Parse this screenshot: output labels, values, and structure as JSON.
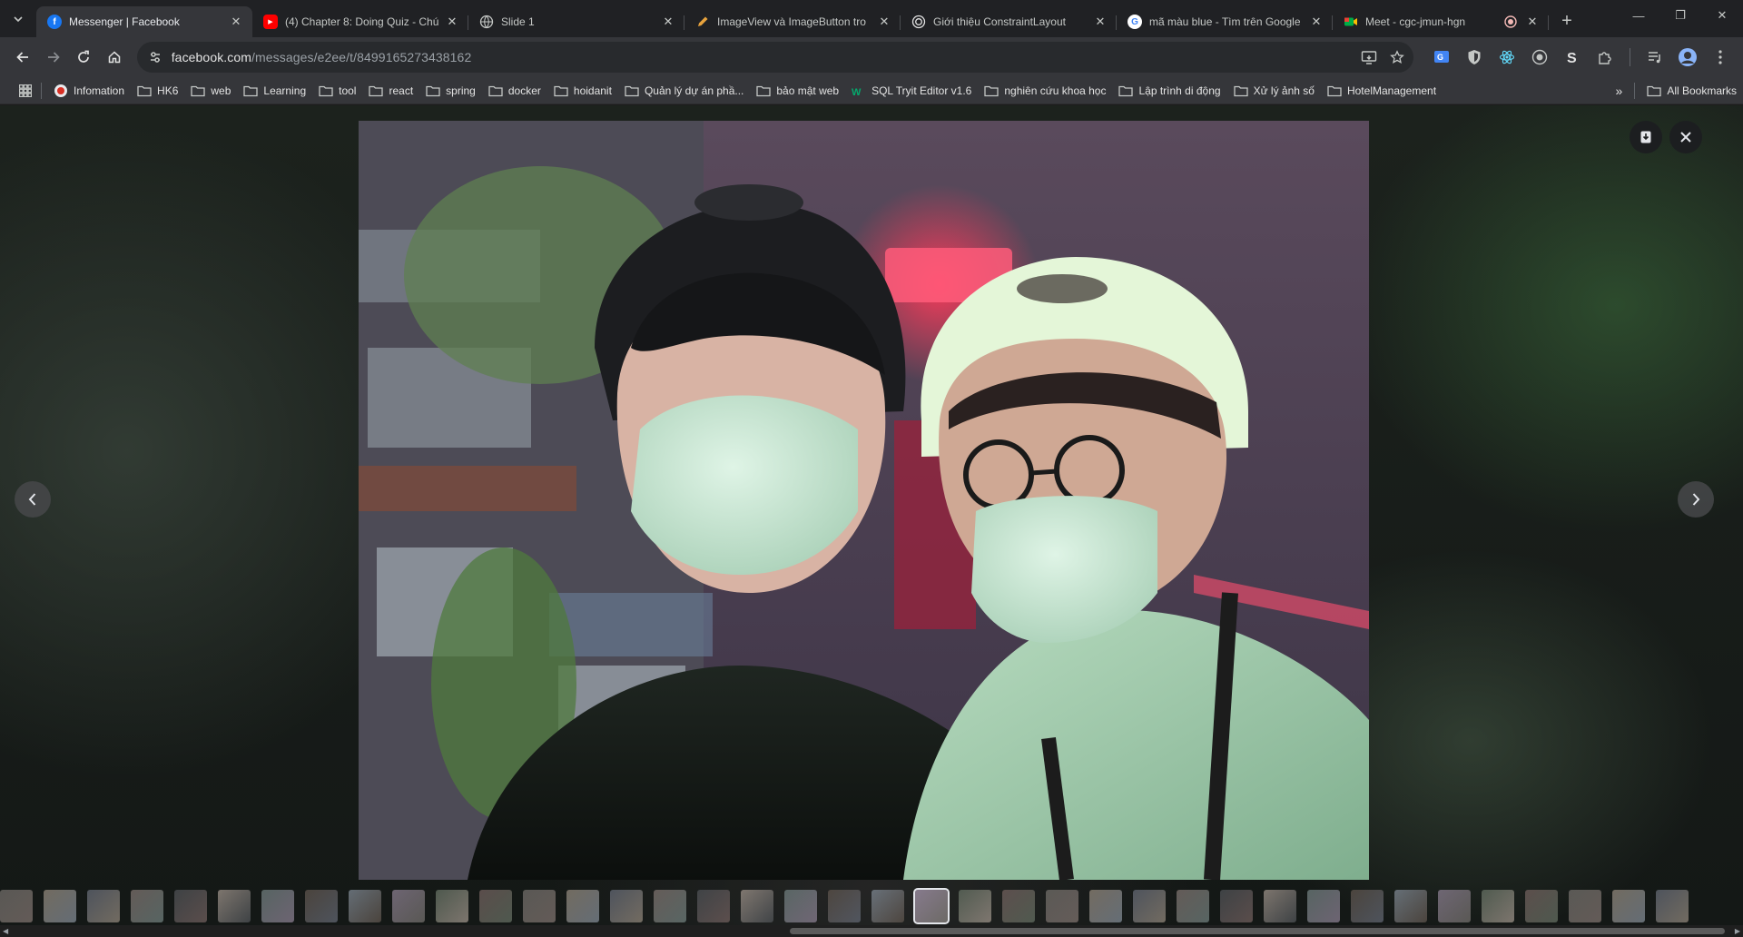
{
  "tabs": [
    {
      "title": "Messenger | Facebook",
      "icon": "facebook-icon",
      "color": "#1877f2",
      "active": true
    },
    {
      "title": "(4) Chapter 8: Doing Quiz - Chú",
      "icon": "youtube-icon",
      "color": "#ff0000",
      "active": false
    },
    {
      "title": "Slide 1",
      "icon": "globe-icon",
      "color": "#9aa0a6",
      "active": false
    },
    {
      "title": "ImageView và ImageButton tro",
      "icon": "pencil-icon",
      "color": "#e8a33d",
      "active": false
    },
    {
      "title": "Giới thiệu ConstraintLayout",
      "icon": "target-icon",
      "color": "#e3e3e3",
      "active": false
    },
    {
      "title": "mã màu blue - Tìm trên Google",
      "icon": "google-icon",
      "color": "#4285f4",
      "active": false
    },
    {
      "title": "Meet - cgc-jmun-hgn",
      "icon": "meet-icon",
      "color": "#00ac47",
      "active": false
    }
  ],
  "address_bar": {
    "host": "facebook.com",
    "path": "/messages/e2ee/t/8499165273438162"
  },
  "bookmarks": [
    {
      "label": "Infomation",
      "icon": "site-icon"
    },
    {
      "label": "HK6",
      "icon": "folder-icon"
    },
    {
      "label": "web",
      "icon": "folder-icon"
    },
    {
      "label": "Learning",
      "icon": "folder-icon"
    },
    {
      "label": "tool",
      "icon": "folder-icon"
    },
    {
      "label": "react",
      "icon": "folder-icon"
    },
    {
      "label": "spring",
      "icon": "folder-icon"
    },
    {
      "label": "docker",
      "icon": "folder-icon"
    },
    {
      "label": "hoidanit",
      "icon": "folder-icon"
    },
    {
      "label": "Quản lý dự án phầ...",
      "icon": "folder-icon"
    },
    {
      "label": "bảo mật web",
      "icon": "folder-icon"
    },
    {
      "label": "SQL Tryit Editor v1.6",
      "icon": "w3-icon"
    },
    {
      "label": "nghiên cứu khoa học",
      "icon": "folder-icon"
    },
    {
      "label": "Lập trình di động",
      "icon": "folder-icon"
    },
    {
      "label": "Xử lý ảnh số",
      "icon": "folder-icon"
    },
    {
      "label": "HotelManagement",
      "icon": "folder-icon"
    }
  ],
  "all_bookmarks_label": "All Bookmarks",
  "viewer": {
    "photo_description_icon": "photo-icon",
    "thumbnail_count": 39,
    "selected_thumbnail": 21
  },
  "colors": {
    "tab_bar": "#202124",
    "toolbar": "#35363a",
    "accent": "#1877f2"
  }
}
